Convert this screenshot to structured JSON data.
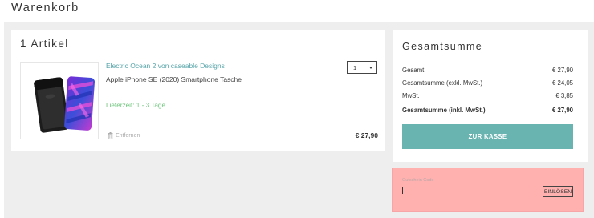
{
  "page": {
    "title": "Warenkorb"
  },
  "cart": {
    "title": "1 Artikel",
    "item": {
      "name": "Electric Ocean 2 von caseable Designs",
      "variant": "Apple iPhone SE (2020) Smartphone Tasche",
      "delivery": "Lieferzeit: 1 - 3 Tage",
      "quantity": "1",
      "remove_label": "Entfernen",
      "price": "€ 27,90"
    }
  },
  "summary": {
    "title": "Gesamtsumme",
    "rows": [
      {
        "label": "Gesamt",
        "value": "€ 27,90"
      },
      {
        "label": "Gesamtsumme (exkl. MwSt.)",
        "value": "€ 24,05"
      },
      {
        "label": "MwSt.",
        "value": "€ 3,85"
      },
      {
        "label": "Gesamtsumme (inkl. MwSt.)",
        "value": "€ 27,90"
      }
    ],
    "checkout_label": "ZUR KASSE"
  },
  "coupon": {
    "label": "Gutschein Code",
    "value": "",
    "button_label": "EINLÖSEN"
  },
  "colors": {
    "accent": "#69b3b0",
    "link": "#55a3a8",
    "delivery_green": "#6cc47a",
    "coupon_highlight": "#ffb1b0"
  },
  "icons": {
    "remove": "trash-icon",
    "quantity": "chevron-down-icon"
  }
}
